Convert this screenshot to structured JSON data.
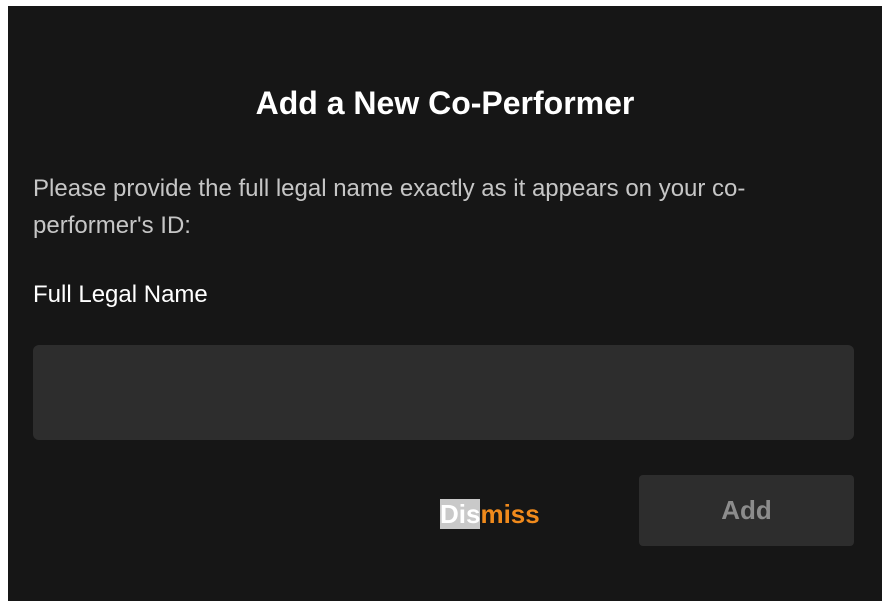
{
  "dialog": {
    "title": "Add a New Co-Performer",
    "description": "Please provide the full legal name exactly as it appears on your co-performer's ID:",
    "field_label": "Full Legal Name",
    "name_input": {
      "value": "",
      "placeholder": ""
    },
    "dismiss": {
      "highlighted": "Dis",
      "rest": "miss"
    },
    "add_label": "Add"
  },
  "colors": {
    "dialog_background": "#161616",
    "input_background": "#2d2d2d",
    "accent": "#f08a1c",
    "add_button_text_disabled": "#8c8c8c"
  }
}
